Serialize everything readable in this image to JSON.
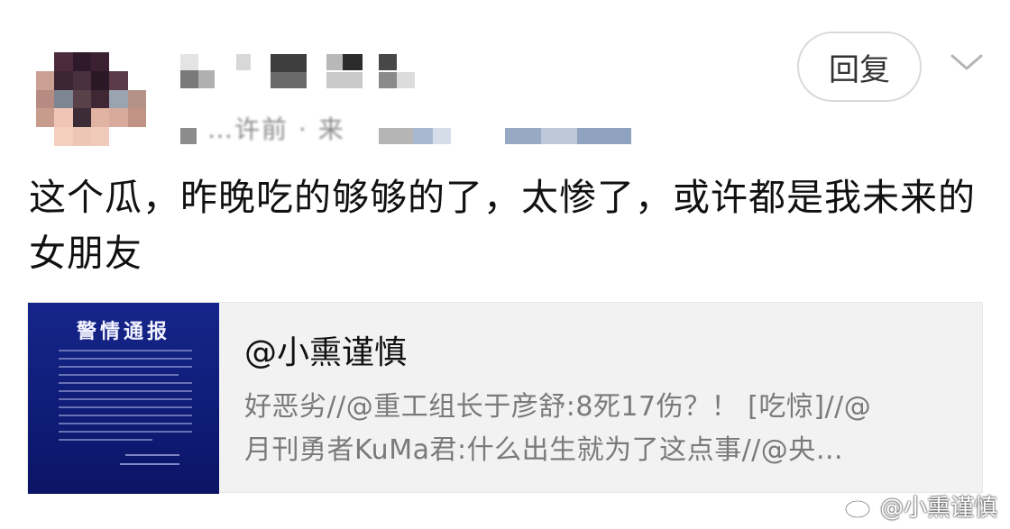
{
  "comment": {
    "username": "",
    "meta": "…许前 · 来",
    "text": "这个瓜，昨晚吃的够够的了，太惨了，或许都是我未来的女朋友"
  },
  "actions": {
    "reply_label": "回复",
    "expand_icon": "chevron-down-icon"
  },
  "repost_card": {
    "thumbnail_title": "警情通报",
    "author": "@小熏谨慎",
    "text": "好恶劣//@重工组长于彦舒:8死17伤？！ [吃惊]//@\n月刊勇者KuMa君:什么出生就为了这点事//@央…"
  },
  "watermark": {
    "icon": "weibo-icon",
    "text": "@小熏谨慎"
  }
}
